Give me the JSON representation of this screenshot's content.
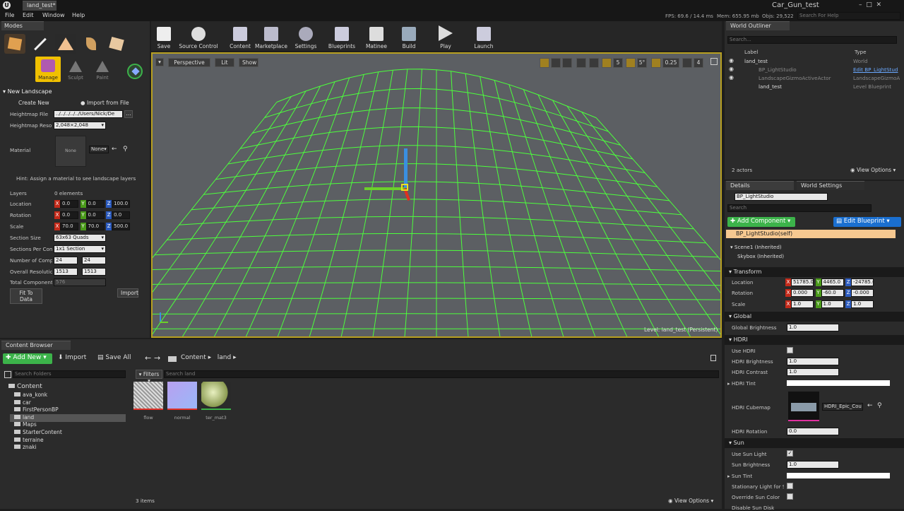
{
  "titlebar": {
    "tab": "land_test*",
    "app_title": "Car_Gun_test",
    "search_placeholder": "Search For Help"
  },
  "menu": [
    "File",
    "Edit",
    "Window",
    "Help"
  ],
  "stats": {
    "fps": "FPS: 69.6 / 14.4 ms",
    "mem": "Mem: 655.95 mb",
    "objs": "Objs: 29,522"
  },
  "modes": {
    "tab": "Modes",
    "subtools": [
      "Manage",
      "Sculpt",
      "Paint"
    ],
    "section": "New Landscape",
    "create_new": "Create New",
    "import_from_file": "Import from File",
    "heightmap_file_label": "Heightmap File",
    "heightmap_file_value": "../../../../../Users/Nick/De",
    "heightmap_res_label": "Heightmap Reso",
    "heightmap_res_value": "2,048×2,048",
    "material_label": "Material",
    "material_thumb": "None",
    "material_select": "None",
    "hint": "Hint: Assign a material to see landscape layers",
    "layers_label": "Layers",
    "layers_value": "0 elements",
    "location_label": "Location",
    "location": [
      "0.0",
      "0.0",
      "100.0"
    ],
    "rotation_label": "Rotation",
    "rotation": [
      "0.0",
      "0.0",
      "0.0"
    ],
    "scale_label": "Scale",
    "scale": [
      "70.0",
      "70.0",
      "500.0"
    ],
    "section_size_label": "Section Size",
    "section_size_value": "63x63 Quads",
    "sections_per_comp_label": "Sections Per Com",
    "sections_per_comp_value": "1x1 Section",
    "num_comp_label": "Number of Compc",
    "num_comp": [
      "24",
      "24"
    ],
    "overall_res_label": "Overall Resolutic",
    "overall_res": [
      "1513",
      "1513"
    ],
    "total_comp_label": "Total Component",
    "total_comp_value": "576",
    "fit_button": "Fit To Data",
    "import_button": "Import"
  },
  "toolbar": [
    "Save",
    "Source Control",
    "Content",
    "Marketplace",
    "Settings",
    "Blueprints",
    "Matinee",
    "Build",
    "Play",
    "Launch"
  ],
  "viewport": {
    "perspective": "Perspective",
    "lit": "Lit",
    "show": "Show",
    "grid_snap": "5",
    "angle_snap": "5°",
    "scale_snap": "0.25",
    "cam_speed": "4",
    "level": "Level: land_test (Persistent)"
  },
  "content_browser": {
    "tab": "Content Browser",
    "add_new": "Add New",
    "import": "Import",
    "save_all": "Save All",
    "crumbs": [
      "Content",
      "land"
    ],
    "search_folders": "Search Folders",
    "filters": "Filters",
    "search_land": "Search land",
    "tree": [
      "Content",
      "ava_konk",
      "car",
      "FirstPersonBP",
      "land",
      "Maps",
      "StarterContent",
      "terraine",
      "znaki"
    ],
    "assets": [
      "flow",
      "normal",
      "ter_mat3"
    ],
    "count": "3 items",
    "view_options": "View Options"
  },
  "outliner": {
    "tab": "World Outliner",
    "search": "Search...",
    "col_label": "Label",
    "col_type": "Type",
    "rows": [
      {
        "label": "land_test",
        "type": "World"
      },
      {
        "label": "BP_LightStudio",
        "type": "Edit BP_LightStud"
      },
      {
        "label": "LandscapeGizmoActiveActor",
        "type": "LandscapeGizmoA"
      },
      {
        "label": "land_test",
        "type": "Level Blueprint"
      }
    ],
    "actors": "2 actors",
    "view_options": "View Options"
  },
  "details": {
    "tab": "Details",
    "tab2": "World Settings",
    "name": "BP_LightStudio",
    "search": "Search",
    "add_component": "Add Component",
    "edit_blueprint": "Edit Blueprint",
    "components": [
      "BP_LightStudio(self)",
      "Scene1 (Inherited)",
      "Skybox (Inherited)"
    ],
    "transform": "Transform",
    "location_label": "Location",
    "location": [
      "51785.0",
      "4465.0",
      "-24785.0"
    ],
    "rotation_label": "Rotation",
    "rotation": [
      "0.000",
      "-60.0",
      "-0.000"
    ],
    "scale_label": "Scale",
    "scale": [
      "1.0",
      "1.0",
      "1.0"
    ],
    "global": "Global",
    "global_brightness_label": "Global Brightness",
    "global_brightness": "1.0",
    "hdri": "HDRI",
    "use_hdri": "Use HDRI",
    "hdri_brightness_label": "HDRI Brightness",
    "hdri_brightness": "1.0",
    "hdri_contrast_label": "HDRI Contrast",
    "hdri_contrast": "1.0",
    "hdri_tint": "HDRI Tint",
    "hdri_cubemap_label": "HDRI Cubemap",
    "hdri_cubemap": "HDRI_Epic_Cou",
    "hdri_rotation_label": "HDRI Rotation",
    "hdri_rotation": "0.0",
    "sun": "Sun",
    "use_sun": "Use Sun Light",
    "sun_brightness_label": "Sun Brightness",
    "sun_brightness": "1.0",
    "sun_tint": "Sun Tint",
    "stationary": "Stationary Light for Su",
    "override_sun": "Override Sun Color",
    "disable_sun": "Disable Sun Disk"
  },
  "colors": {
    "accent": "#f0c000",
    "green": "#3cb34a",
    "blue": "#1a6fd0",
    "wire": "#4cff3c"
  }
}
